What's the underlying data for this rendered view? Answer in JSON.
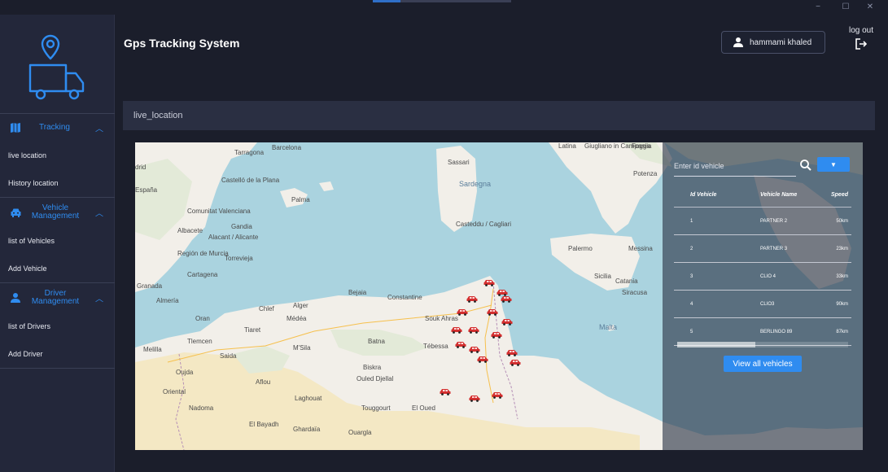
{
  "window": {
    "minimize_glyph": "−",
    "maximize_glyph": "☐",
    "close_glyph": "✕"
  },
  "header": {
    "title": "Gps Tracking System",
    "user_name": "hammami khaled",
    "logout_label": "log out"
  },
  "sidebar": {
    "groups": [
      {
        "label": "Tracking",
        "icon": "map-icon",
        "items": [
          "live location",
          "History location"
        ]
      },
      {
        "label": "Vehicle Management",
        "icon": "car-icon",
        "items": [
          "list of Vehicles",
          "Add Vehicle"
        ]
      },
      {
        "label": "Driver Management",
        "icon": "person-icon",
        "items": [
          "list of Drivers",
          "Add Driver"
        ]
      }
    ]
  },
  "panel": {
    "title": "live_location"
  },
  "map": {
    "labels": [
      "Tarragona",
      "Barcelona",
      "drid",
      "Castelló de la Plana",
      "España",
      "Palma",
      "Comunitat Valenciana",
      "Albacete",
      "Gandia",
      "Alacant / Alicante",
      "Región de Murcia",
      "Torrevieja",
      "Cartagena",
      "Granada",
      "Almería",
      "Sassari",
      "Sardegna",
      "Casteddu / Cagliari",
      "Palermo",
      "Messina",
      "Sicilia",
      "Catania",
      "Siracusa",
      "Malta",
      "Latina",
      "Giugliano in Campania",
      "Foggia",
      "Potenza",
      "Bejaia",
      "Constantine",
      "Alger",
      "Médéa",
      "Tiaret",
      "Chlef",
      "Oran",
      "Tlemcen",
      "Melilla",
      "Oujda",
      "Biskra",
      "Ouled Djellal",
      "Laghouat",
      "Touggourt",
      "El Oued",
      "Ouargla",
      "Ghardaïa",
      "El Bayadh",
      "Aflou",
      "Nadoma",
      "Oriental",
      "Souk Ahras",
      "Tébessa",
      "Batna",
      "M'Sila",
      "Saida",
      "Tiaret"
    ],
    "vehicle_marker_count": 18
  },
  "vehicle_panel": {
    "search_placeholder": "Enter id vehicle",
    "columns": [
      "Id Vehicle",
      "Vehicle Name",
      "Speed"
    ],
    "rows": [
      {
        "id": "1",
        "name": "PARTNER 2",
        "speed": "50km"
      },
      {
        "id": "2",
        "name": "PARTNER 3",
        "speed": "23km"
      },
      {
        "id": "3",
        "name": "CLIO 4",
        "speed": "33km"
      },
      {
        "id": "4",
        "name": "CLIO3",
        "speed": "90km"
      },
      {
        "id": "5",
        "name": "BERLINGO 89",
        "speed": "87km"
      }
    ],
    "view_all_label": "View all vehicles"
  },
  "colors": {
    "accent": "#2f8cf0",
    "background": "#1b1e2b",
    "sidebar": "#23273a",
    "vehicle_marker": "#d32f2f"
  }
}
